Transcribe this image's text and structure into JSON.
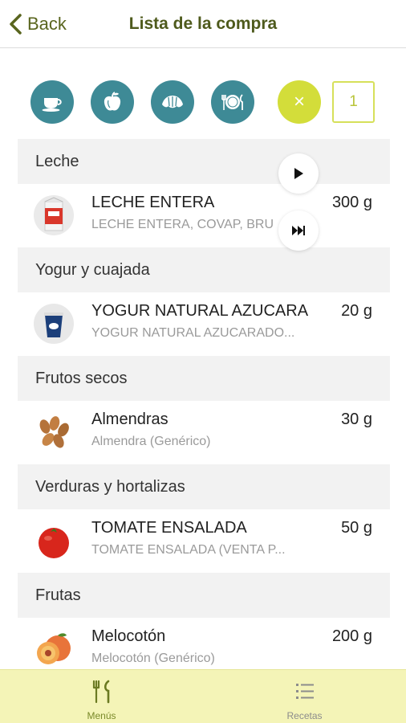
{
  "header": {
    "back_label": "Back",
    "title": "Lista de la compra"
  },
  "meals": {
    "icons": [
      "coffee-cup-icon",
      "apple-icon",
      "croissant-icon",
      "plate-cutlery-icon"
    ],
    "close_label": "×",
    "count": "1"
  },
  "colors": {
    "accent_teal": "#3e8a96",
    "accent_lime": "#d3dd3a",
    "title_olive": "#4e5a1c",
    "nav_background": "#f4f4b7"
  },
  "categories": [
    {
      "name": "Leche",
      "items": [
        {
          "name": "LECHE ENTERA",
          "sub": "LECHE ENTERA, COVAP, BRU",
          "qty": "300 g",
          "image": "milk-carton"
        }
      ]
    },
    {
      "name": "Yogur y cuajada",
      "items": [
        {
          "name": "YOGUR NATURAL AZUCARA",
          "sub": "YOGUR NATURAL AZUCARADO...",
          "qty": "20 g",
          "image": "yogurt"
        }
      ]
    },
    {
      "name": "Frutos secos",
      "items": [
        {
          "name": "Almendras",
          "sub": "Almendra (Genérico)",
          "qty": "30 g",
          "image": "almonds"
        }
      ]
    },
    {
      "name": "Verduras y hortalizas",
      "items": [
        {
          "name": "TOMATE ENSALADA",
          "sub": "TOMATE ENSALADA (VENTA P...",
          "qty": "50 g",
          "image": "tomato"
        }
      ]
    },
    {
      "name": "Frutas",
      "items": [
        {
          "name": "Melocotón",
          "sub": "Melocotón (Genérico)",
          "qty": "200 g",
          "image": "peach"
        }
      ]
    }
  ],
  "media_controls": {
    "play_icon": "play-icon",
    "skip_icon": "skip-next-icon"
  },
  "bottom_nav": {
    "menus_label": "Menús",
    "menus_color": "#7a8a2a",
    "recetas_label": "Recetas",
    "recetas_color": "#8c8c8c"
  }
}
